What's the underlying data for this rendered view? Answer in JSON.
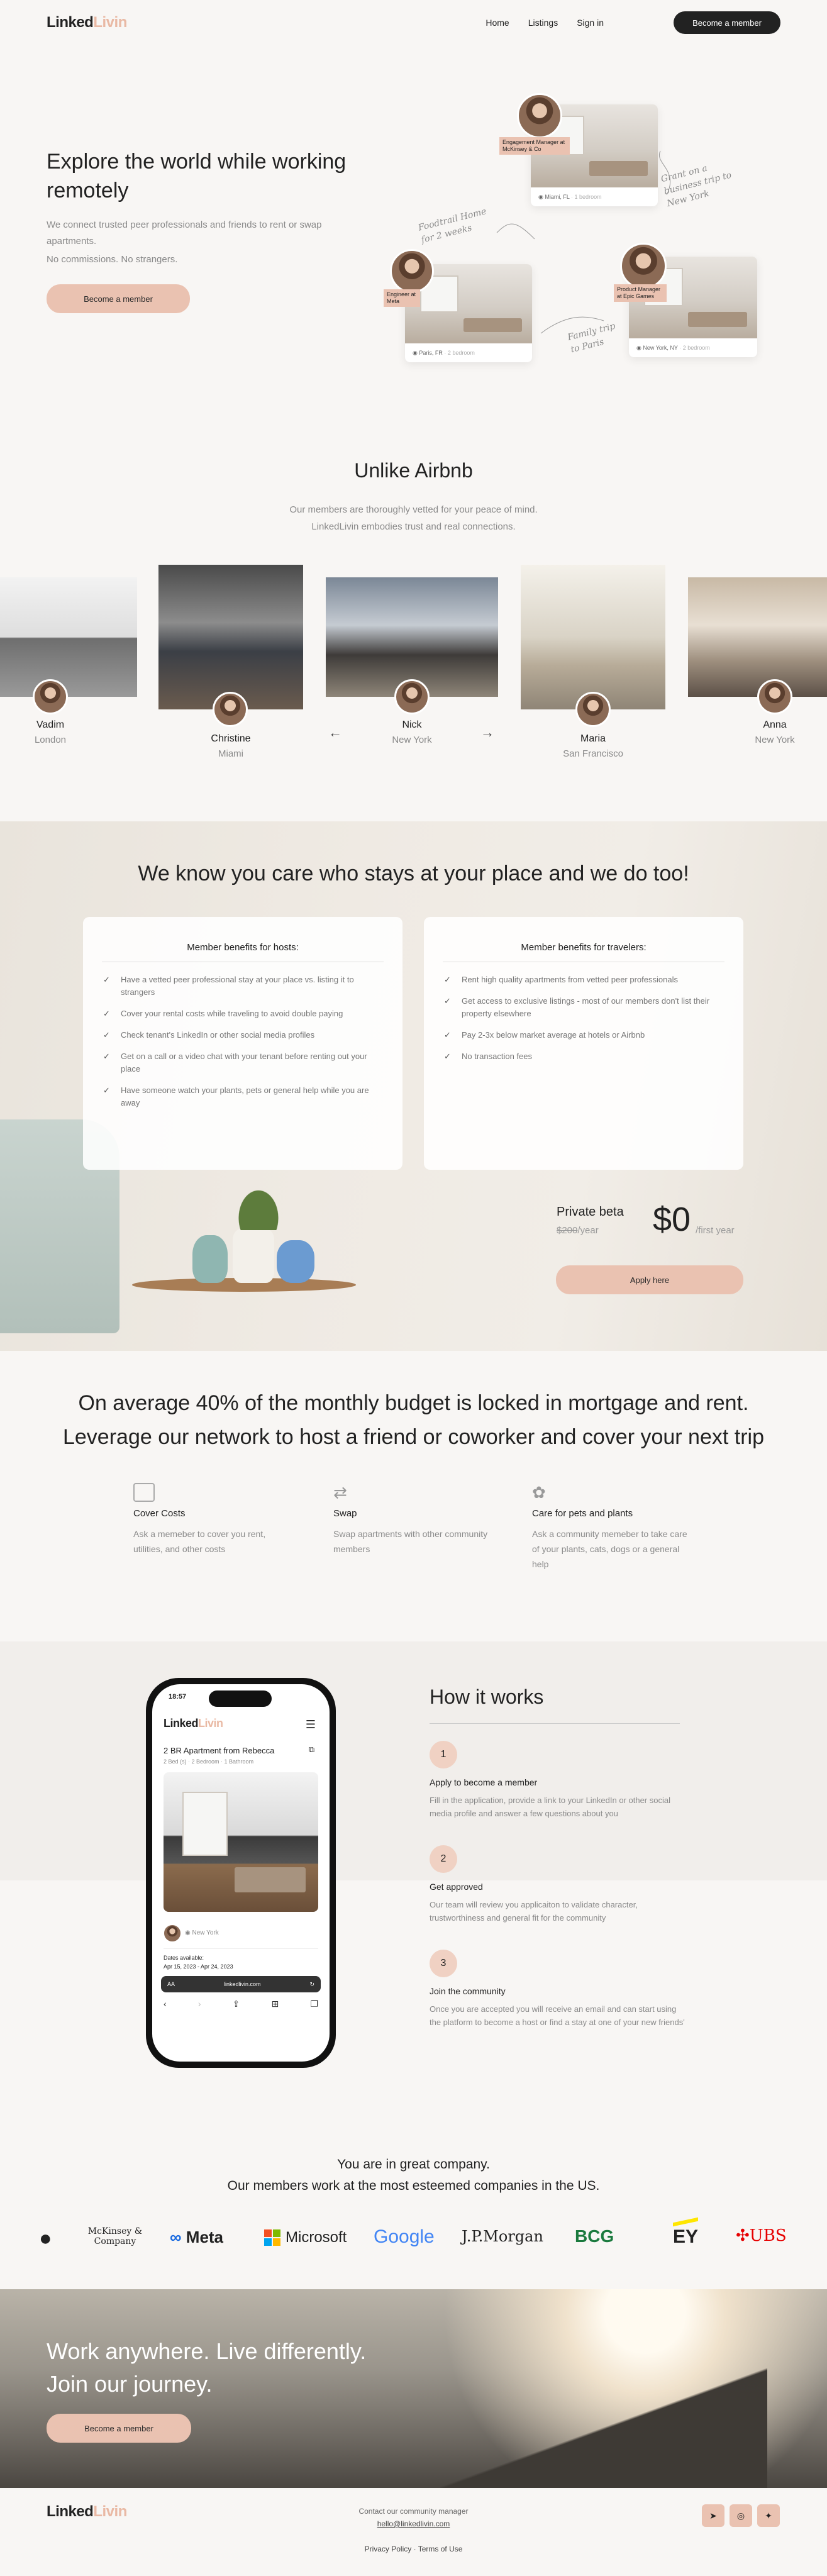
{
  "brand": {
    "logo_primary": "Linked",
    "logo_accent": "Livin",
    "accent_color": "#eac2b1",
    "logo_accent_color": "#e9b9a4"
  },
  "nav": {
    "home": "Home",
    "listings": "Listings",
    "signin": "Sign in",
    "cta": "Become a member"
  },
  "hero": {
    "title": "Explore the world while working remotely",
    "text1": "We connect trusted peer professionals and friends to rent or swap apartments.",
    "text2": "No commissions. No strangers.",
    "cta": "Become a member",
    "cards": [
      {
        "tag": "Engagement Manager at McKinsey & Co",
        "loc": "Miami, FL",
        "loc_sub": "· 1 bedroom"
      },
      {
        "tag": "Engineer at Meta",
        "loc": "Paris, FR",
        "loc_sub": "· 2 bedroom"
      },
      {
        "tag": "Product Manager at Epic Games",
        "loc": "New York, NY",
        "loc_sub": "· 2 bedroom"
      }
    ],
    "notes": {
      "n1": "Grant on a business trip to New York",
      "n2": "Foodtrail Home for 2 weeks",
      "n3": "Family trip to Paris"
    }
  },
  "unlike": {
    "title": "Unlike Airbnb",
    "text1": "Our members are thoroughly vetted for your peace of mind.",
    "text2": "LinkedLivin embodies trust and real connections.",
    "people": [
      {
        "name": "Vadim",
        "city": "London"
      },
      {
        "name": "Christine",
        "city": "Miami"
      },
      {
        "name": "Nick",
        "city": "New York"
      },
      {
        "name": "Maria",
        "city": "San Francisco"
      },
      {
        "name": "Anna",
        "city": "New York"
      }
    ],
    "prev": "←",
    "next": "→"
  },
  "care": {
    "title": "We know you care who stays at your place and we do too!",
    "hosts_title": "Member benefits for hosts:",
    "hosts": [
      "Have a vetted peer professional stay at your place vs. listing it to strangers",
      "Cover your rental costs while traveling to avoid double paying",
      "Check tenant's LinkedIn or other social media profiles",
      "Get on a call or a video chat with your tenant before renting out your place",
      "Have someone watch your plants, pets or general help while you are away"
    ],
    "travelers_title": "Member benefits for travelers:",
    "travelers": [
      "Rent high quality apartments from vetted peer professionals",
      "Get access to exclusive listings - most of our members don't list their property elsewhere",
      "Pay 2-3x below market average at hotels or Airbnb",
      "No transaction fees"
    ],
    "beta": {
      "label": "Private beta",
      "old_price": "$200",
      "old_unit": "/year",
      "price": "$0",
      "price_unit": "/first year",
      "cta": "Apply here"
    }
  },
  "budget": {
    "line1": "On average 40% of the monthly budget is locked in mortgage and rent.",
    "line2": "Leverage our network to host a friend or coworker and cover your next trip",
    "features": [
      {
        "icon": "wallet-icon",
        "title": "Cover Costs",
        "text": "Ask a memeber to cover you rent, utilities, and other costs"
      },
      {
        "icon": "swap-icon",
        "title": "Swap",
        "text": "Swap apartments with other community members"
      },
      {
        "icon": "paw-icon",
        "title": "Care for pets and plants",
        "text": "Ask a community memeber to take care of your plants, cats, dogs or a general help"
      }
    ]
  },
  "how": {
    "title": "How it works",
    "steps": [
      {
        "num": "1",
        "title": "Apply to become a member",
        "text": "Fill in the application, provide a link to your LinkedIn or other social media profile and answer a few questions about you"
      },
      {
        "num": "2",
        "title": "Get approved",
        "text": "Our team will review you applicaiton to validate character, trustworthiness and general fit for the community"
      },
      {
        "num": "3",
        "title": "Join the community",
        "text": "Once you are accepted you will receive an email and can start using the platform to become a host or find a stay at one of your new friends'"
      }
    ],
    "phone": {
      "time": "18:57",
      "listing": "2 BR Apartment from Rebecca",
      "specs": "2 Bed (s) · 2 Bedroom · 1 Bathroom",
      "city": "New York",
      "dates_label": "Dates available:",
      "dates": "Apr 15, 2023 - Apr 24, 2023",
      "aa": "AA",
      "url": "linkedlivin.com"
    }
  },
  "company": {
    "line1": "You are in great company.",
    "line2": "Our members work at the most esteemed companies in the US.",
    "logos": [
      "McKinsey & Company",
      "Meta",
      "Microsoft",
      "Google",
      "J.P.Morgan",
      "BCG",
      "EY",
      "UBS"
    ]
  },
  "cta_section": {
    "line1": "Work anywhere. Live differently.",
    "line2": "Join our journey.",
    "cta": "Become a member"
  },
  "footer": {
    "contact": "Contact our community manager",
    "email": "hello@linkedlivin.com",
    "privacy": "Privacy Policy",
    "terms": "Terms of Use",
    "sep": "·"
  }
}
